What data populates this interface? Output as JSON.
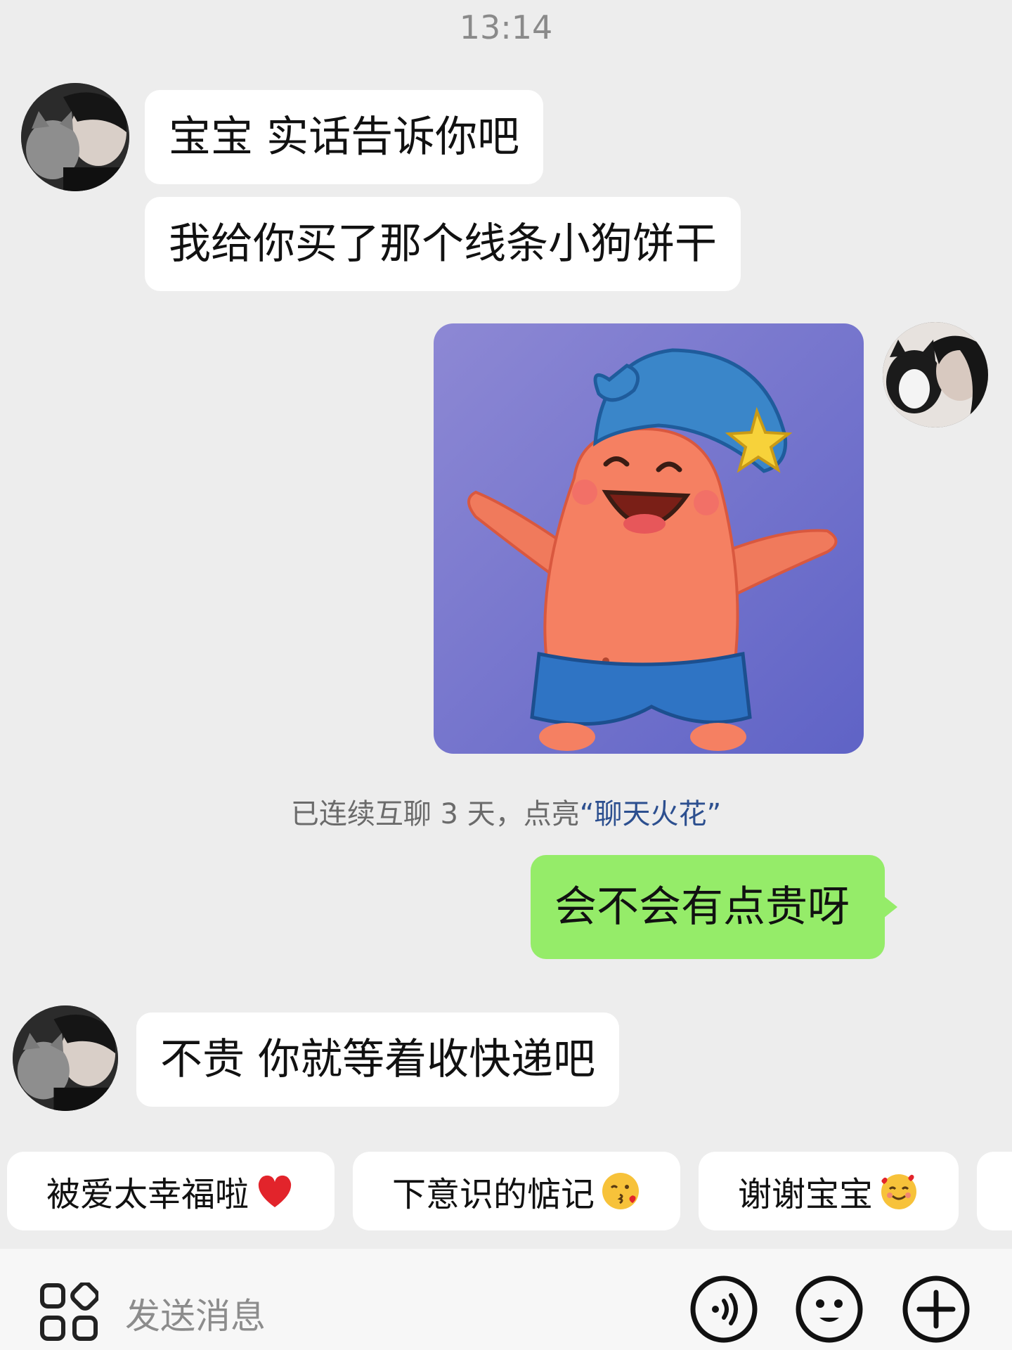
{
  "status": {
    "time": "13:14"
  },
  "messages": [
    {
      "side": "left",
      "text": "宝宝 实话告诉你吧"
    },
    {
      "side": "left",
      "text": "我给你买了那个线条小狗饼干"
    },
    {
      "side": "right",
      "type": "sticker",
      "sticker_icon": "patrick-star-sticker"
    },
    {
      "side": "right",
      "text": "会不会有点贵呀"
    },
    {
      "side": "left",
      "text": "不贵 你就等着收快递吧"
    }
  ],
  "notice": {
    "prefix": "已连续互聊 3 天，点亮",
    "highlight": "“聊天火花”"
  },
  "quick_replies": [
    {
      "label": "被爱太幸福啦",
      "emoji": "red-heart-icon"
    },
    {
      "label": "下意识的惦记",
      "emoji": "kissing-face-icon"
    },
    {
      "label": "谢谢宝宝",
      "emoji": "smiling-hearts-face-icon"
    }
  ],
  "input": {
    "placeholder": "发送消息"
  },
  "colors": {
    "background": "#ededed",
    "sent_bubble": "#95ec69",
    "received_bubble": "#ffffff",
    "spark_text": "#2c4f8f"
  }
}
